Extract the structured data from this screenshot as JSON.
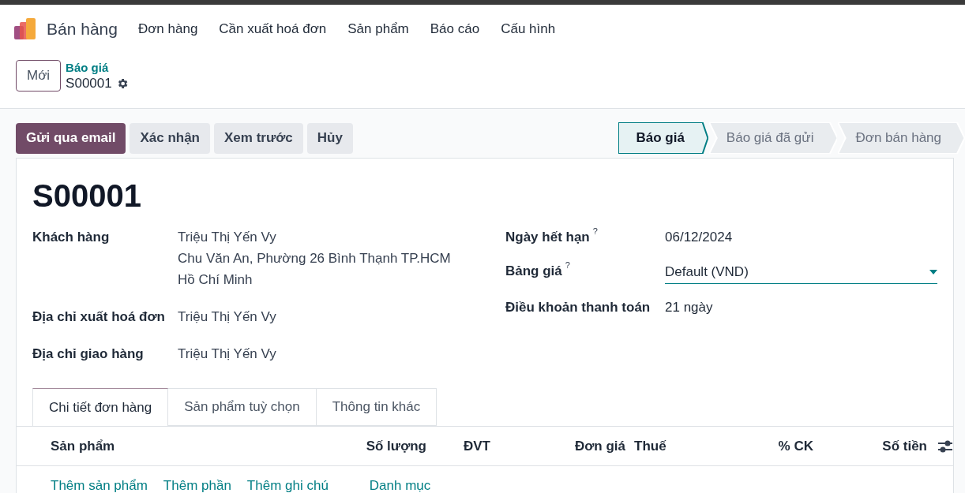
{
  "app": {
    "name": "Bán hàng"
  },
  "menu": [
    "Đơn hàng",
    "Cần xuất hoá đơn",
    "Sản phẩm",
    "Báo cáo",
    "Cấu hình"
  ],
  "new_button": "Mới",
  "breadcrumb": {
    "parent": "Báo giá",
    "current": "S00001"
  },
  "actions": [
    {
      "label": "Gửi qua email",
      "kind": "primary"
    },
    {
      "label": "Xác nhận",
      "kind": "secondary"
    },
    {
      "label": "Xem trước",
      "kind": "secondary"
    },
    {
      "label": "Hủy",
      "kind": "secondary"
    }
  ],
  "status_steps": [
    {
      "label": "Báo giá",
      "selected": true
    },
    {
      "label": "Báo giá đã gửi",
      "selected": false
    },
    {
      "label": "Đơn bán hàng",
      "selected": false
    }
  ],
  "record_title": "S00001",
  "left_fields": [
    {
      "label": "Khách hàng",
      "lines": [
        "Triệu Thị Yến Vy",
        "Chu Văn An, Phường 26 Bình Thạnh TP.HCM",
        "Hồ Chí Minh"
      ]
    },
    {
      "label": "Địa chỉ xuất hoá đơn",
      "lines": [
        "Triệu Thị Yến Vy"
      ]
    },
    {
      "label": "Địa chỉ giao hàng",
      "lines": [
        "Triệu Thị Yến Vy"
      ]
    }
  ],
  "right_fields": [
    {
      "label": "Ngày hết hạn",
      "help": "?",
      "value": "06/12/2024",
      "kind": "text"
    },
    {
      "label": "Bảng giá",
      "help": "?",
      "value": "Default (VND)",
      "kind": "select"
    },
    {
      "label": "Điều khoản thanh toán",
      "value": "21 ngày",
      "kind": "text"
    }
  ],
  "tabs": [
    {
      "label": "Chi tiết đơn hàng",
      "selected": true
    },
    {
      "label": "Sản phẩm tuỳ chọn",
      "selected": false
    },
    {
      "label": "Thông tin khác",
      "selected": false
    }
  ],
  "table": {
    "columns": [
      "Sản phẩm",
      "Số lượng",
      "ĐVT",
      "Đơn giá",
      "Thuế",
      "% CK",
      "Số tiền"
    ],
    "add_links": [
      "Thêm sản phẩm",
      "Thêm phần",
      "Thêm ghi chú",
      "Danh mục"
    ]
  }
}
